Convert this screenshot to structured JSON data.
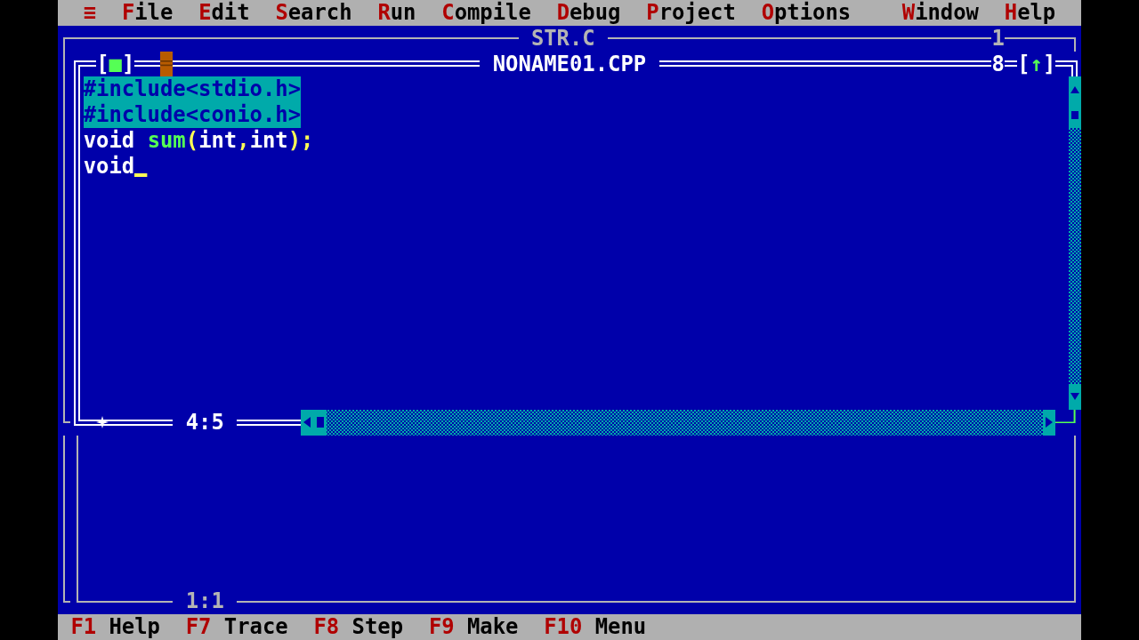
{
  "menu_bar": {
    "items": [
      {
        "label": "≡"
      },
      {
        "label": "File"
      },
      {
        "label": "Edit"
      },
      {
        "label": "Search"
      },
      {
        "label": "Run"
      },
      {
        "label": "Compile"
      },
      {
        "label": "Debug"
      },
      {
        "label": "Project"
      },
      {
        "label": "Options"
      }
    ],
    "right_items": [
      {
        "label": "Window"
      },
      {
        "label": "Help"
      }
    ]
  },
  "background_window": {
    "title": "STR.C",
    "number": "1",
    "active": false
  },
  "editor_window": {
    "active": true,
    "close_button": "[■]",
    "title": "NONAME01.CPP",
    "number": "8",
    "zoom_button": "[↑]",
    "lines": [
      {
        "selected": true,
        "cursor": false,
        "tokens": [
          {
            "kind": "preprocessor",
            "text": "#include<stdio.h>"
          }
        ]
      },
      {
        "selected": true,
        "cursor": false,
        "tokens": [
          {
            "kind": "preprocessor",
            "text": "#include<conio.h>"
          }
        ]
      },
      {
        "selected": false,
        "cursor": false,
        "tokens": [
          {
            "kind": "keyword",
            "text": "void "
          },
          {
            "kind": "identifier",
            "text": "sum"
          },
          {
            "kind": "symbol",
            "text": "("
          },
          {
            "kind": "keyword",
            "text": "int"
          },
          {
            "kind": "symbol",
            "text": ","
          },
          {
            "kind": "keyword",
            "text": "int"
          },
          {
            "kind": "symbol",
            "text": ");"
          }
        ]
      },
      {
        "selected": false,
        "cursor": true,
        "tokens": [
          {
            "kind": "keyword",
            "text": "void"
          }
        ]
      }
    ],
    "modified": true,
    "position": "4:5"
  },
  "lower_window": {
    "active": false,
    "position": "1:1"
  },
  "status_bar": [
    {
      "key": "F1",
      "label": "Help"
    },
    {
      "key": "F7",
      "label": "Trace"
    },
    {
      "key": "F8",
      "label": "Step"
    },
    {
      "key": "F9",
      "label": "Make"
    },
    {
      "key": "F10",
      "label": "Menu"
    }
  ]
}
